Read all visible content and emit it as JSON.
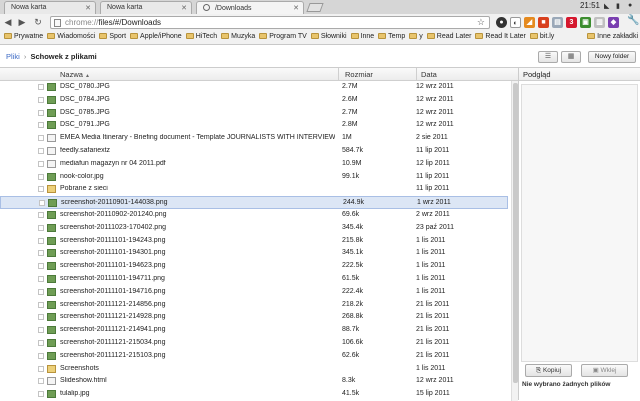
{
  "tabs": [
    {
      "label": "Nowa karta"
    },
    {
      "label": "Nowa karta"
    },
    {
      "label": "/Downloads"
    }
  ],
  "clock": "21:51",
  "address": {
    "scheme": "chrome://",
    "path": "files/#/Downloads"
  },
  "bookmarks": [
    "Prywatne",
    "Wiadomości",
    "Sport",
    "Apple/iPhone",
    "HiTech",
    "Muzyka",
    "Program TV",
    "Słowniki",
    "Inne",
    "Temp",
    "y",
    "Read Later",
    "Read It Later",
    "bit.ly"
  ],
  "bookmarks_other": "Inne zakładki",
  "breadcrumb": {
    "root": "Pliki",
    "sep": "›",
    "current": "Schowek z plikami"
  },
  "buttons": {
    "new_folder": "Nowy folder",
    "copy": "Kopiuj",
    "paste": "Wklej"
  },
  "columns": {
    "name": "Nazwa",
    "sort_mark": "▲",
    "size": "Rozmiar",
    "date": "Data"
  },
  "files": [
    {
      "name": "DSC_0780.JPG",
      "size": "2.7M",
      "date": "12 wrz 2011",
      "type": "img"
    },
    {
      "name": "DSC_0784.JPG",
      "size": "2.6M",
      "date": "12 wrz 2011",
      "type": "img"
    },
    {
      "name": "DSC_0785.JPG",
      "size": "2.7M",
      "date": "12 wrz 2011",
      "type": "img"
    },
    {
      "name": "DSC_0791.JPG",
      "size": "2.8M",
      "date": "12 wrz 2011",
      "type": "img"
    },
    {
      "name": "EMEA Media Itinerary - Briefing document - Template JOURNALISTS WITH INTERVIEWS...",
      "size": "1M",
      "date": "2 sie 2011",
      "type": "doc"
    },
    {
      "name": "feedly.safariextz",
      "size": "584.7k",
      "date": "11 lip 2011",
      "type": "doc"
    },
    {
      "name": "mediafun magazyn nr 04 2011.pdf",
      "size": "10.9M",
      "date": "12 lip 2011",
      "type": "doc"
    },
    {
      "name": "nook-color.jpg",
      "size": "99.1k",
      "date": "11 lip 2011",
      "type": "img"
    },
    {
      "name": "Pobrane z sieci",
      "size": "",
      "date": "11 lip 2011",
      "type": "folder"
    },
    {
      "name": "screenshot-20110901-144038.png",
      "size": "244.9k",
      "date": "1 wrz 2011",
      "type": "img",
      "selected": true
    },
    {
      "name": "screenshot-20110902-201240.png",
      "size": "69.6k",
      "date": "2 wrz 2011",
      "type": "img"
    },
    {
      "name": "screenshot-20111023-170402.png",
      "size": "345.4k",
      "date": "23 paź 2011",
      "type": "img"
    },
    {
      "name": "screenshot-20111101-194243.png",
      "size": "215.8k",
      "date": "1 lis 2011",
      "type": "img"
    },
    {
      "name": "screenshot-20111101-194301.png",
      "size": "345.1k",
      "date": "1 lis 2011",
      "type": "img"
    },
    {
      "name": "screenshot-20111101-194623.png",
      "size": "222.5k",
      "date": "1 lis 2011",
      "type": "img"
    },
    {
      "name": "screenshot-20111101-194711.png",
      "size": "61.5k",
      "date": "1 lis 2011",
      "type": "img"
    },
    {
      "name": "screenshot-20111101-194716.png",
      "size": "222.4k",
      "date": "1 lis 2011",
      "type": "img"
    },
    {
      "name": "screenshot-20111121-214856.png",
      "size": "218.2k",
      "date": "21 lis 2011",
      "type": "img"
    },
    {
      "name": "screenshot-20111121-214928.png",
      "size": "268.8k",
      "date": "21 lis 2011",
      "type": "img"
    },
    {
      "name": "screenshot-20111121-214941.png",
      "size": "88.7k",
      "date": "21 lis 2011",
      "type": "img"
    },
    {
      "name": "screenshot-20111121-215034.png",
      "size": "106.6k",
      "date": "21 lis 2011",
      "type": "img"
    },
    {
      "name": "screenshot-20111121-215103.png",
      "size": "62.6k",
      "date": "21 lis 2011",
      "type": "img"
    },
    {
      "name": "Screenshots",
      "size": "",
      "date": "1 lis 2011",
      "type": "folder"
    },
    {
      "name": "Slideshow.html",
      "size": "8.3k",
      "date": "12 wrz 2011",
      "type": "doc"
    },
    {
      "name": "tulalip.jpg",
      "size": "41.5k",
      "date": "15 lip 2011",
      "type": "img"
    }
  ],
  "preview": {
    "title": "Podgląd",
    "status": "Nie wybrano żadnych plików"
  },
  "colors": {
    "accent": "#3a68c4",
    "selected_row": "#dce6f5"
  }
}
